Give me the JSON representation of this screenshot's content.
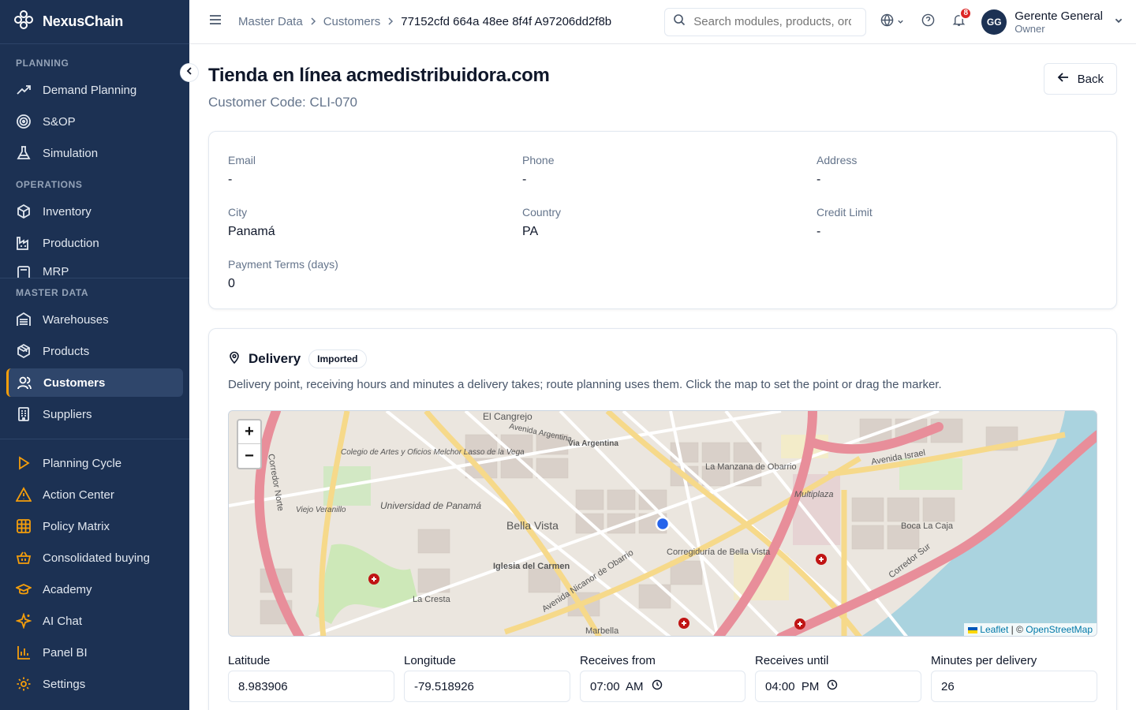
{
  "brand": {
    "name": "NexusChain"
  },
  "sidebar": {
    "sections": [
      {
        "label": "PLANNING",
        "items": [
          {
            "label": "Demand Planning",
            "icon": "trend-up-icon"
          },
          {
            "label": "S&OP",
            "icon": "target-icon"
          },
          {
            "label": "Simulation",
            "icon": "flask-icon"
          }
        ]
      },
      {
        "label": "OPERATIONS",
        "items": [
          {
            "label": "Inventory",
            "icon": "box-icon"
          },
          {
            "label": "Production",
            "icon": "factory-icon"
          },
          {
            "label": "MRP",
            "icon": "calculator-icon"
          }
        ]
      },
      {
        "label": "MASTER DATA",
        "items": [
          {
            "label": "Warehouses",
            "icon": "warehouse-icon"
          },
          {
            "label": "Products",
            "icon": "package-icon"
          },
          {
            "label": "Customers",
            "icon": "users-icon",
            "active": true
          },
          {
            "label": "Suppliers",
            "icon": "building-icon"
          }
        ]
      }
    ],
    "bottom_items": [
      {
        "label": "Planning Cycle",
        "icon": "play-icon"
      },
      {
        "label": "Action Center",
        "icon": "alert-triangle-icon"
      },
      {
        "label": "Policy Matrix",
        "icon": "grid-icon"
      },
      {
        "label": "Consolidated buying",
        "icon": "basket-icon"
      },
      {
        "label": "Academy",
        "icon": "graduation-cap-icon"
      },
      {
        "label": "AI Chat",
        "icon": "sparkles-icon"
      },
      {
        "label": "Panel BI",
        "icon": "bar-chart-icon"
      },
      {
        "label": "Settings",
        "icon": "gear-icon"
      }
    ],
    "accent": "#f59e0b",
    "bg": "#1c3153"
  },
  "topbar": {
    "breadcrumb": [
      "Master Data",
      "Customers",
      "77152cfd 664a 48ee 8f4f A97206dd2f8b"
    ],
    "search_placeholder": "Search modules, products, orders...",
    "notifications": "8",
    "user": {
      "initials": "GG",
      "name": "Gerente General",
      "role": "Owner"
    }
  },
  "page": {
    "title": "Tienda en línea acmedistribuidora.com",
    "subtitle": "Customer Code: CLI-070",
    "back_label": "Back"
  },
  "info": {
    "fields": [
      {
        "label": "Email",
        "value": "-"
      },
      {
        "label": "Phone",
        "value": "-"
      },
      {
        "label": "Address",
        "value": "-"
      },
      {
        "label": "City",
        "value": "Panamá"
      },
      {
        "label": "Country",
        "value": "PA"
      },
      {
        "label": "Credit Limit",
        "value": "-"
      },
      {
        "label": "Payment Terms (days)",
        "value": "0"
      }
    ]
  },
  "delivery": {
    "title": "Delivery",
    "badge": "Imported",
    "description": "Delivery point, receiving hours and minutes a delivery takes; route planning uses them. Click the map to set the point or drag the marker.",
    "map": {
      "zoom_in": "+",
      "zoom_out": "−",
      "attribution_leaflet": "Leaflet",
      "attribution_sep": " | © ",
      "attribution_osm": "OpenStreetMap",
      "labels": {
        "el_cangrejo": "El Cangrejo",
        "bella_vista": "Bella Vista",
        "universidad": "Universidad de Panamá",
        "la_manzana": "La Manzana de Obarrio",
        "corregiduria": "Corregiduría de Bella Vista",
        "iglesia": "Iglesia del Carmen",
        "la_cresta": "La Cresta",
        "marbella": "Marbella",
        "boca_la_caja": "Boca La Caja",
        "multiplaza": "Multiplaza",
        "av_israel": "Avenida Israel",
        "corredor_sur": "Corredor Sur",
        "corredor_norte": "Corredor Norte",
        "av_argentina": "Avenida Argentina",
        "via_argentina": "Via Argentina",
        "av_nicanor": "Avenida Nicanor de Obarrio",
        "colegio": "Colegio de Artes y Oficios Melchor Lasso de la Vega",
        "viejo_veranillo": "Viejo Veranillo"
      }
    },
    "fields": [
      {
        "label": "Latitude",
        "value": "8.983906"
      },
      {
        "label": "Longitude",
        "value": "-79.518926"
      },
      {
        "label": "Receives from",
        "value": "07:00  AM"
      },
      {
        "label": "Receives until",
        "value": "04:00  PM"
      },
      {
        "label": "Minutes per delivery",
        "value": "26"
      }
    ]
  }
}
